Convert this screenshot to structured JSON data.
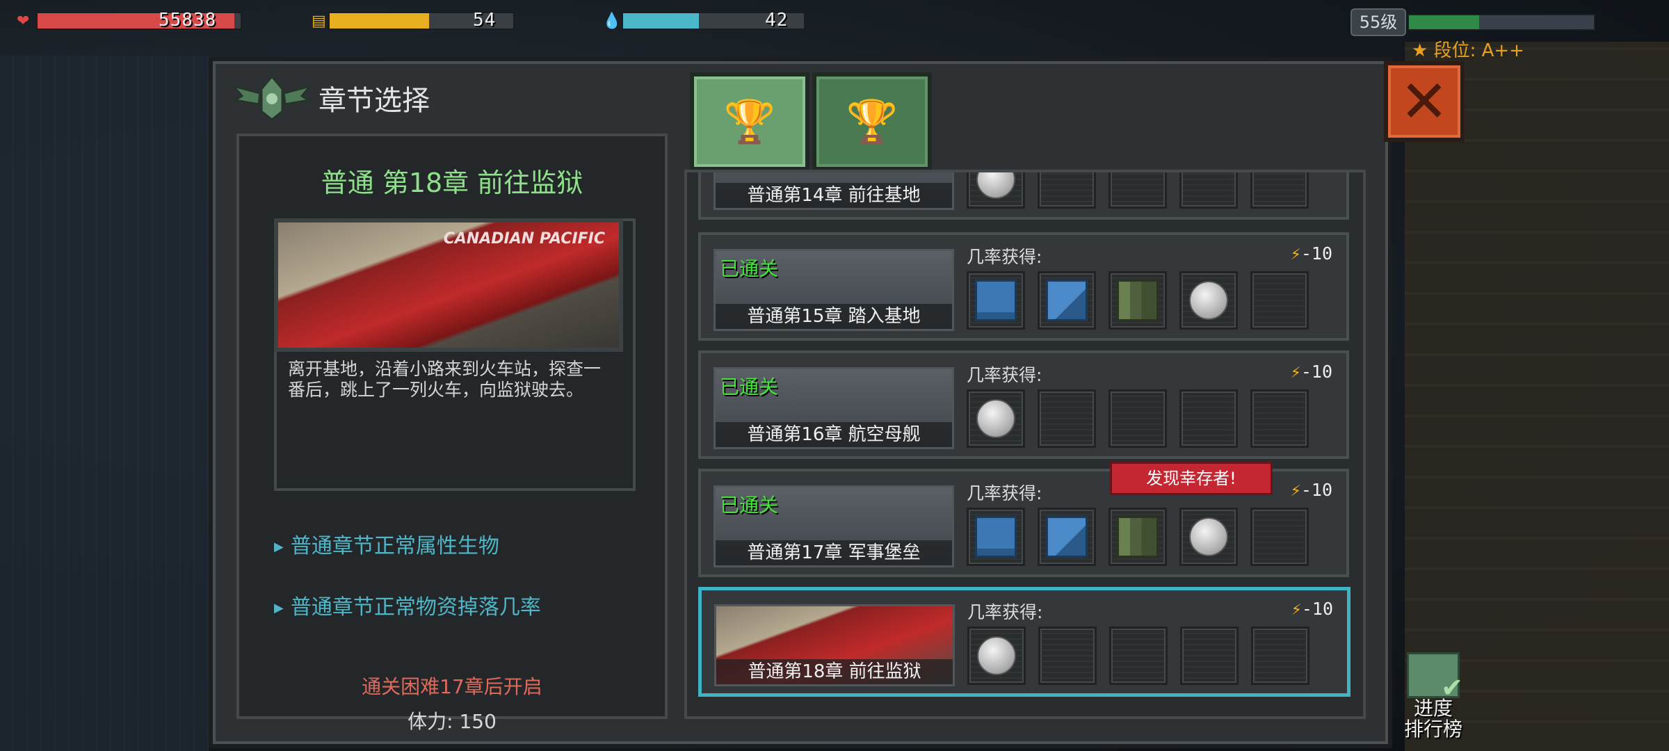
{
  "hud": {
    "hp": {
      "value": "55838",
      "fill": 0.97,
      "color": "#d84a4a"
    },
    "food": {
      "value": "54",
      "fill": 0.54,
      "color": "#e8b020"
    },
    "water": {
      "value": "42",
      "fill": 0.42,
      "color": "#4ab8c8"
    },
    "level": "55级",
    "level_fill": 0.38,
    "rank": "★ 段位: A++"
  },
  "panel": {
    "title": "章节选择",
    "close_label": "✕"
  },
  "detail": {
    "title": "普通 第18章 前往监狱",
    "image_text": "CANADIAN PACIFIC",
    "description": "离开基地，沿着小路来到火车站，探查一番后，跳上了一列火车，向监狱驶去。",
    "link1": "普通章节正常属性生物",
    "link2": "普通章节正常物资掉落几率",
    "unlock_hint": "通关困难17章后开启",
    "stamina": "体力: 150"
  },
  "chapters": [
    {
      "name": "普通第14章 前往基地",
      "cleared": "",
      "rate_label": "",
      "cost": "",
      "slots": [
        "coin",
        "empty",
        "empty",
        "empty",
        "empty"
      ]
    },
    {
      "name": "普通第15章 踏入基地",
      "cleared": "已通关",
      "rate_label": "几率获得:",
      "cost": "-10",
      "slots": [
        "box",
        "gun",
        "ammo",
        "coin",
        "empty"
      ]
    },
    {
      "name": "普通第16章 航空母舰",
      "cleared": "已通关",
      "rate_label": "几率获得:",
      "cost": "-10",
      "slots": [
        "coin",
        "empty",
        "empty",
        "empty",
        "empty"
      ]
    },
    {
      "name": "普通第17章 军事堡垒",
      "cleared": "已通关",
      "rate_label": "几率获得:",
      "cost": "-10",
      "slots": [
        "box",
        "gun",
        "ammo",
        "coin",
        "empty"
      ]
    },
    {
      "name": "普通第18章 前往监狱",
      "cleared": "",
      "rate_label": "几率获得:",
      "cost": "-10",
      "slots": [
        "coin",
        "empty",
        "empty",
        "empty",
        "empty"
      ]
    }
  ],
  "survivor_tag": "发现幸存者!",
  "progress_button": {
    "line1": "进度",
    "line2": "排行榜"
  }
}
